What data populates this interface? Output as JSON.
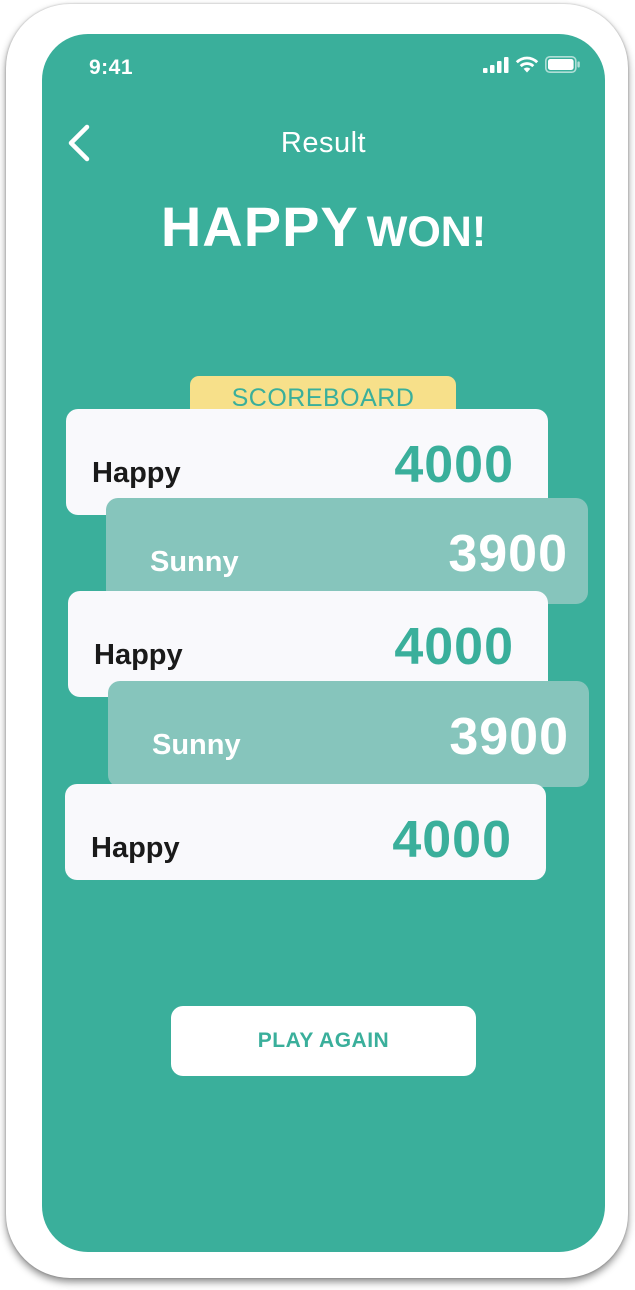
{
  "status_bar": {
    "time": "9:41",
    "icons": [
      "cellular-signal-icon",
      "wifi-icon",
      "battery-icon"
    ]
  },
  "header": {
    "back_icon": "chevron-left-icon",
    "title": "Result"
  },
  "winner": {
    "name": "HAPPY",
    "suffix": "WON!"
  },
  "scoreboard": {
    "label": "SCOREBOARD",
    "rows": [
      {
        "name": "Happy",
        "score": "4000"
      },
      {
        "name": "Sunny",
        "score": "3900"
      },
      {
        "name": "Happy",
        "score": "4000"
      },
      {
        "name": "Sunny",
        "score": "3900"
      },
      {
        "name": "Happy",
        "score": "4000"
      }
    ]
  },
  "actions": {
    "play_again_label": "PLAY AGAIN"
  },
  "colors": {
    "background": "#3aaf9b",
    "card_light": "#f9f9fc",
    "card_teal": "#86c5bc",
    "tab_yellow": "#f7e08a"
  }
}
